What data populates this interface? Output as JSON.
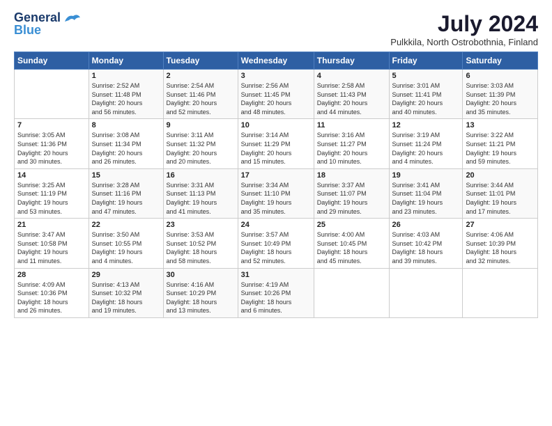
{
  "logo": {
    "line1": "General",
    "line2": "Blue"
  },
  "title": {
    "month_year": "July 2024",
    "location": "Pulkkila, North Ostrobothnia, Finland"
  },
  "days_of_week": [
    "Sunday",
    "Monday",
    "Tuesday",
    "Wednesday",
    "Thursday",
    "Friday",
    "Saturday"
  ],
  "weeks": [
    [
      {
        "day": "",
        "info": ""
      },
      {
        "day": "1",
        "info": "Sunrise: 2:52 AM\nSunset: 11:48 PM\nDaylight: 20 hours\nand 56 minutes."
      },
      {
        "day": "2",
        "info": "Sunrise: 2:54 AM\nSunset: 11:46 PM\nDaylight: 20 hours\nand 52 minutes."
      },
      {
        "day": "3",
        "info": "Sunrise: 2:56 AM\nSunset: 11:45 PM\nDaylight: 20 hours\nand 48 minutes."
      },
      {
        "day": "4",
        "info": "Sunrise: 2:58 AM\nSunset: 11:43 PM\nDaylight: 20 hours\nand 44 minutes."
      },
      {
        "day": "5",
        "info": "Sunrise: 3:01 AM\nSunset: 11:41 PM\nDaylight: 20 hours\nand 40 minutes."
      },
      {
        "day": "6",
        "info": "Sunrise: 3:03 AM\nSunset: 11:39 PM\nDaylight: 20 hours\nand 35 minutes."
      }
    ],
    [
      {
        "day": "7",
        "info": "Sunrise: 3:05 AM\nSunset: 11:36 PM\nDaylight: 20 hours\nand 30 minutes."
      },
      {
        "day": "8",
        "info": "Sunrise: 3:08 AM\nSunset: 11:34 PM\nDaylight: 20 hours\nand 26 minutes."
      },
      {
        "day": "9",
        "info": "Sunrise: 3:11 AM\nSunset: 11:32 PM\nDaylight: 20 hours\nand 20 minutes."
      },
      {
        "day": "10",
        "info": "Sunrise: 3:14 AM\nSunset: 11:29 PM\nDaylight: 20 hours\nand 15 minutes."
      },
      {
        "day": "11",
        "info": "Sunrise: 3:16 AM\nSunset: 11:27 PM\nDaylight: 20 hours\nand 10 minutes."
      },
      {
        "day": "12",
        "info": "Sunrise: 3:19 AM\nSunset: 11:24 PM\nDaylight: 20 hours\nand 4 minutes."
      },
      {
        "day": "13",
        "info": "Sunrise: 3:22 AM\nSunset: 11:21 PM\nDaylight: 19 hours\nand 59 minutes."
      }
    ],
    [
      {
        "day": "14",
        "info": "Sunrise: 3:25 AM\nSunset: 11:19 PM\nDaylight: 19 hours\nand 53 minutes."
      },
      {
        "day": "15",
        "info": "Sunrise: 3:28 AM\nSunset: 11:16 PM\nDaylight: 19 hours\nand 47 minutes."
      },
      {
        "day": "16",
        "info": "Sunrise: 3:31 AM\nSunset: 11:13 PM\nDaylight: 19 hours\nand 41 minutes."
      },
      {
        "day": "17",
        "info": "Sunrise: 3:34 AM\nSunset: 11:10 PM\nDaylight: 19 hours\nand 35 minutes."
      },
      {
        "day": "18",
        "info": "Sunrise: 3:37 AM\nSunset: 11:07 PM\nDaylight: 19 hours\nand 29 minutes."
      },
      {
        "day": "19",
        "info": "Sunrise: 3:41 AM\nSunset: 11:04 PM\nDaylight: 19 hours\nand 23 minutes."
      },
      {
        "day": "20",
        "info": "Sunrise: 3:44 AM\nSunset: 11:01 PM\nDaylight: 19 hours\nand 17 minutes."
      }
    ],
    [
      {
        "day": "21",
        "info": "Sunrise: 3:47 AM\nSunset: 10:58 PM\nDaylight: 19 hours\nand 11 minutes."
      },
      {
        "day": "22",
        "info": "Sunrise: 3:50 AM\nSunset: 10:55 PM\nDaylight: 19 hours\nand 4 minutes."
      },
      {
        "day": "23",
        "info": "Sunrise: 3:53 AM\nSunset: 10:52 PM\nDaylight: 18 hours\nand 58 minutes."
      },
      {
        "day": "24",
        "info": "Sunrise: 3:57 AM\nSunset: 10:49 PM\nDaylight: 18 hours\nand 52 minutes."
      },
      {
        "day": "25",
        "info": "Sunrise: 4:00 AM\nSunset: 10:45 PM\nDaylight: 18 hours\nand 45 minutes."
      },
      {
        "day": "26",
        "info": "Sunrise: 4:03 AM\nSunset: 10:42 PM\nDaylight: 18 hours\nand 39 minutes."
      },
      {
        "day": "27",
        "info": "Sunrise: 4:06 AM\nSunset: 10:39 PM\nDaylight: 18 hours\nand 32 minutes."
      }
    ],
    [
      {
        "day": "28",
        "info": "Sunrise: 4:09 AM\nSunset: 10:36 PM\nDaylight: 18 hours\nand 26 minutes."
      },
      {
        "day": "29",
        "info": "Sunrise: 4:13 AM\nSunset: 10:32 PM\nDaylight: 18 hours\nand 19 minutes."
      },
      {
        "day": "30",
        "info": "Sunrise: 4:16 AM\nSunset: 10:29 PM\nDaylight: 18 hours\nand 13 minutes."
      },
      {
        "day": "31",
        "info": "Sunrise: 4:19 AM\nSunset: 10:26 PM\nDaylight: 18 hours\nand 6 minutes."
      },
      {
        "day": "",
        "info": ""
      },
      {
        "day": "",
        "info": ""
      },
      {
        "day": "",
        "info": ""
      }
    ]
  ]
}
